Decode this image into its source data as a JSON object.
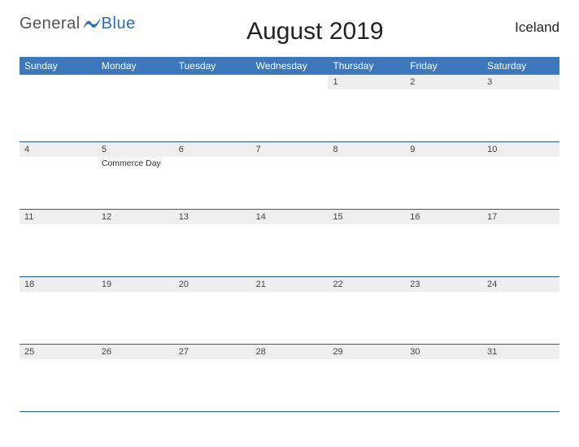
{
  "brand": {
    "general": "General",
    "blue": "Blue"
  },
  "title": "August 2019",
  "region": "Iceland",
  "day_names": [
    "Sunday",
    "Monday",
    "Tuesday",
    "Wednesday",
    "Thursday",
    "Friday",
    "Saturday"
  ],
  "weeks": [
    [
      {
        "day": "",
        "event": ""
      },
      {
        "day": "",
        "event": ""
      },
      {
        "day": "",
        "event": ""
      },
      {
        "day": "",
        "event": ""
      },
      {
        "day": "1",
        "event": ""
      },
      {
        "day": "2",
        "event": ""
      },
      {
        "day": "3",
        "event": ""
      }
    ],
    [
      {
        "day": "4",
        "event": ""
      },
      {
        "day": "5",
        "event": "Commerce Day"
      },
      {
        "day": "6",
        "event": ""
      },
      {
        "day": "7",
        "event": ""
      },
      {
        "day": "8",
        "event": ""
      },
      {
        "day": "9",
        "event": ""
      },
      {
        "day": "10",
        "event": ""
      }
    ],
    [
      {
        "day": "11",
        "event": ""
      },
      {
        "day": "12",
        "event": ""
      },
      {
        "day": "13",
        "event": ""
      },
      {
        "day": "14",
        "event": ""
      },
      {
        "day": "15",
        "event": ""
      },
      {
        "day": "16",
        "event": ""
      },
      {
        "day": "17",
        "event": ""
      }
    ],
    [
      {
        "day": "18",
        "event": ""
      },
      {
        "day": "19",
        "event": ""
      },
      {
        "day": "20",
        "event": ""
      },
      {
        "day": "21",
        "event": ""
      },
      {
        "day": "22",
        "event": ""
      },
      {
        "day": "23",
        "event": ""
      },
      {
        "day": "24",
        "event": ""
      }
    ],
    [
      {
        "day": "25",
        "event": ""
      },
      {
        "day": "26",
        "event": ""
      },
      {
        "day": "27",
        "event": ""
      },
      {
        "day": "28",
        "event": ""
      },
      {
        "day": "29",
        "event": ""
      },
      {
        "day": "30",
        "event": ""
      },
      {
        "day": "31",
        "event": ""
      }
    ]
  ]
}
